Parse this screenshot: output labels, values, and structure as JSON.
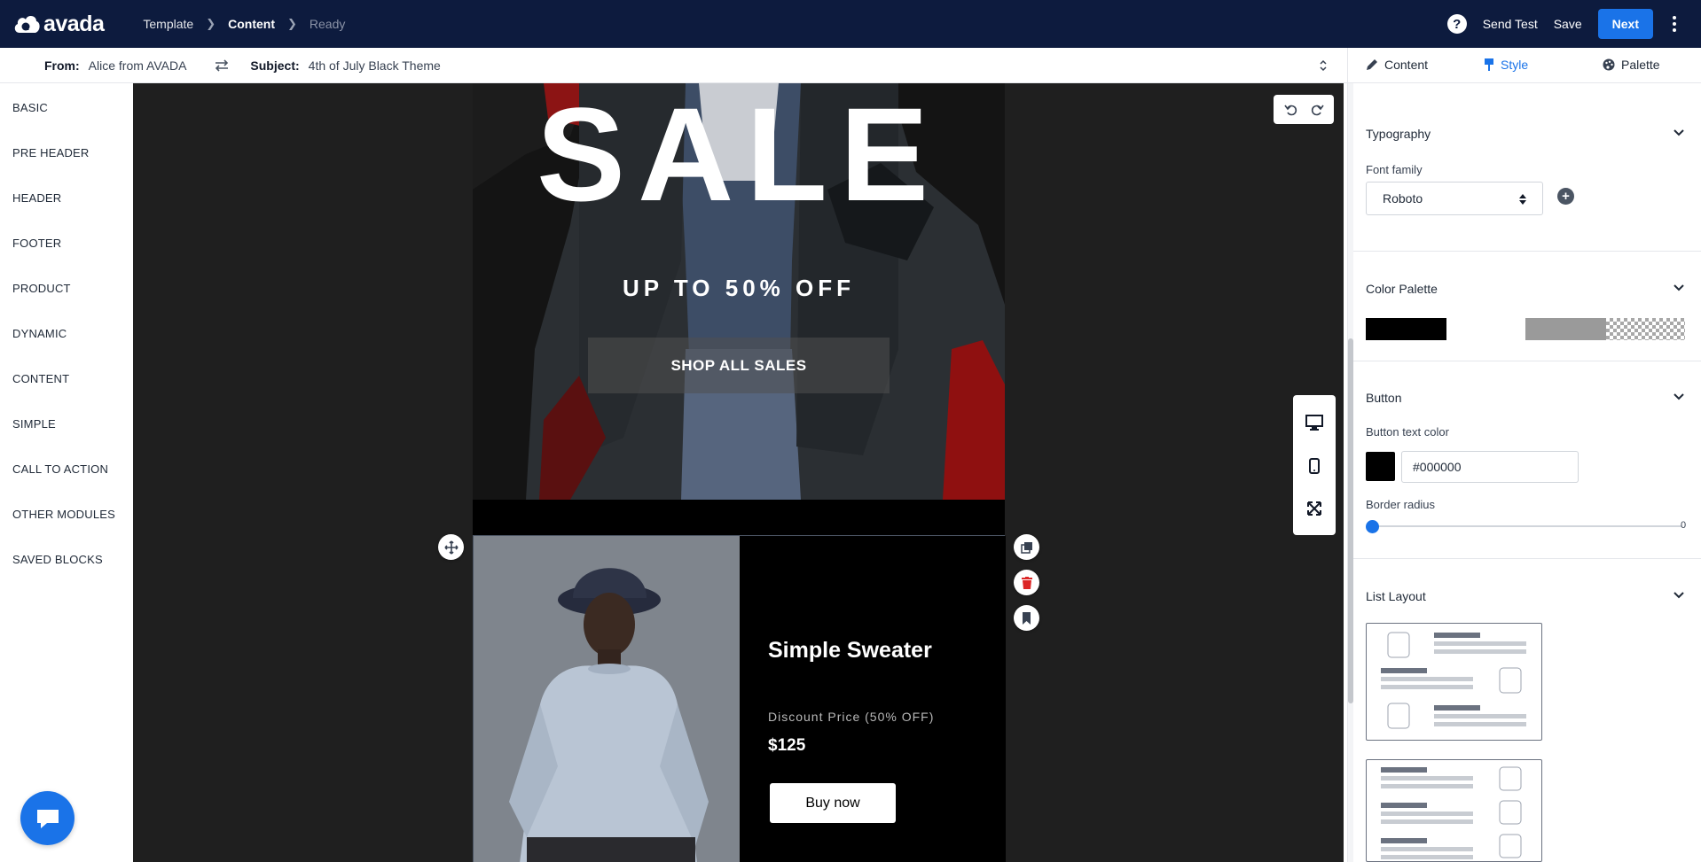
{
  "app": {
    "brand": "avada"
  },
  "breadcrumb": {
    "items": [
      "Template",
      "Content",
      "Ready"
    ]
  },
  "topbar": {
    "send_test": "Send Test",
    "save": "Save",
    "next": "Next",
    "help": "?"
  },
  "subject_bar": {
    "from_label": "From:",
    "from_value": "Alice from AVADA",
    "subject_label": "Subject:",
    "subject_value": "4th of July Black Theme"
  },
  "left_nav": {
    "items": [
      "BASIC",
      "PRE HEADER",
      "HEADER",
      "FOOTER",
      "PRODUCT",
      "DYNAMIC",
      "CONTENT",
      "SIMPLE",
      "CALL TO ACTION",
      "OTHER MODULES",
      "SAVED BLOCKS"
    ]
  },
  "email": {
    "hero": {
      "title": "SALE",
      "subtitle": "UP TO 50% OFF",
      "button": "SHOP ALL SALES"
    },
    "product": {
      "title": "Simple Sweater",
      "discount": "Discount Price (50% OFF)",
      "price": "$125",
      "button": "Buy now"
    }
  },
  "right_panel": {
    "tabs": [
      "Content",
      "Style",
      "Palette"
    ],
    "active_tab": "Style",
    "typography": {
      "title": "Typography",
      "font_family_label": "Font family",
      "font_family_value": "Roboto"
    },
    "color_palette": {
      "title": "Color Palette",
      "colors": [
        "#000000",
        "#9a9a9a",
        "transparent"
      ]
    },
    "button": {
      "title": "Button",
      "text_color_label": "Button text color",
      "text_color_value": "#000000",
      "border_radius_label": "Border radius",
      "border_radius_value": "0"
    },
    "list_layout": {
      "title": "List Layout"
    }
  },
  "colors": {
    "topbar": "#0d1b3e",
    "accent": "#1a73e8",
    "canvas": "#1f1f1f"
  }
}
